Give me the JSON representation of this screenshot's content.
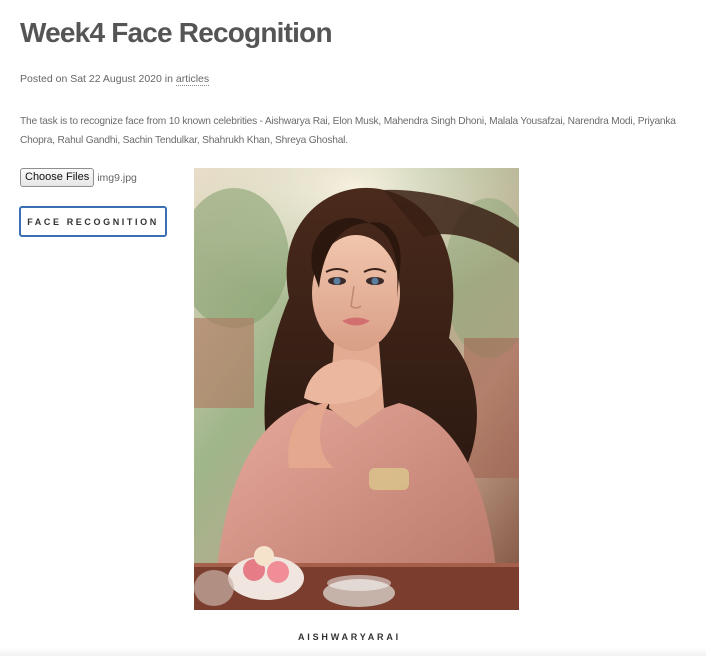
{
  "post": {
    "title": "Week4 Face Recognition",
    "meta_prefix": "Posted on Sat 22 August 2020 in",
    "category_link": "articles",
    "description": "The task is to recognize face from 10 known celebrities - Aishwarya Rai, Elon Musk, Mahendra Singh Dhoni, Malala Yousafzai, Narendra Modi, Priyanka Chopra, Rahul Gandhi, Sachin Tendulkar, Shahrukh Khan, Shreya Ghoshal."
  },
  "form": {
    "choose_files_label": "Choose Files",
    "selected_file": "img9.jpg",
    "submit_label": "FACE RECOGNITION"
  },
  "result": {
    "label": "AISHWARYARAI"
  },
  "colors": {
    "accent_border": "#3b6fb3",
    "title_text": "#555555"
  }
}
